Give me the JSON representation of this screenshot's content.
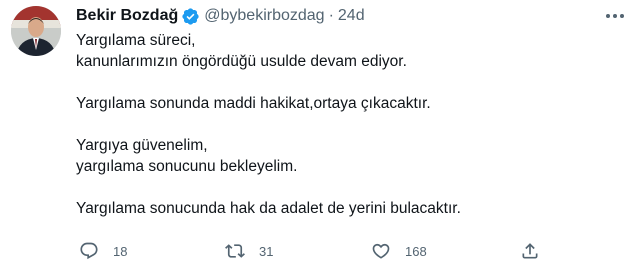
{
  "tweet": {
    "author_name": "Bekir Bozdağ",
    "handle": "@bybekirbozdag",
    "separator": "·",
    "time": "24d",
    "paragraphs": [
      [
        "Yargılama süreci,",
        "kanunlarımızın öngördüğü usulde devam ediyor."
      ],
      [
        "Yargılama sonunda maddi hakikat,ortaya çıkacaktır."
      ],
      [
        "Yargıya güvenelim,",
        "yargılama sonucunu bekleyelim."
      ],
      [
        "Yargılama sonucunda hak da adalet de yerini bulacaktır."
      ]
    ],
    "actions": {
      "reply_count": "18",
      "retweet_count": "31",
      "like_count": "168"
    }
  },
  "icons": {
    "verified": "verified-badge-icon",
    "more": "more-options-icon",
    "reply": "reply-icon",
    "retweet": "retweet-icon",
    "like": "like-icon",
    "share": "share-icon"
  },
  "colors": {
    "verified_blue": "#1d9bf0",
    "text": "#0f1419",
    "secondary": "#536471"
  }
}
